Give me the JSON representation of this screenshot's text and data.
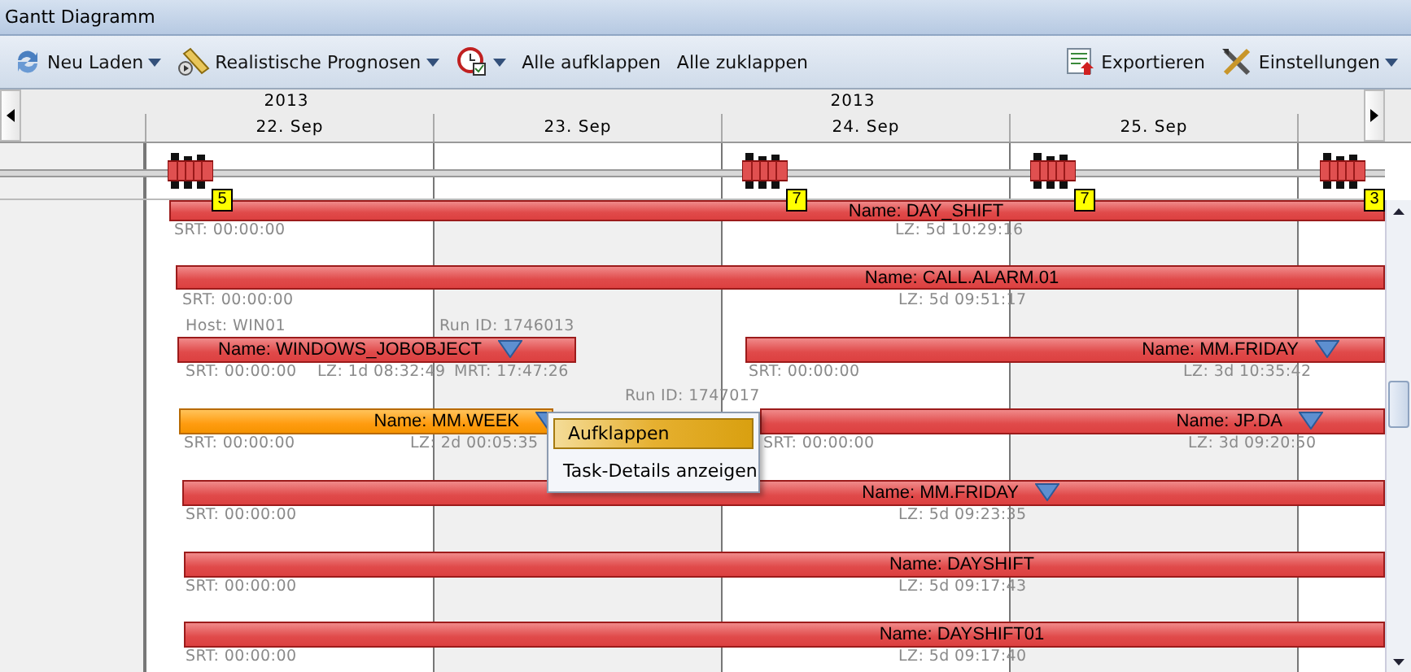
{
  "window": {
    "title": "Gantt Diagramm"
  },
  "toolbar": {
    "left": [
      {
        "label": "Neu Laden",
        "dropdown": true
      },
      {
        "label": "Realistische Prognosen",
        "dropdown": true
      },
      {
        "dropdown": true
      },
      {
        "label": "Alle aufklappen",
        "dropdown": false
      },
      {
        "label": "Alle zuklappen",
        "dropdown": false
      }
    ],
    "right": [
      {
        "label": "Exportieren",
        "dropdown": false
      },
      {
        "label": "Einstellungen",
        "dropdown": true
      }
    ]
  },
  "timeline": {
    "years": [
      "2013",
      "2013"
    ],
    "days": [
      "22. Sep",
      "23. Sep",
      "24. Sep",
      "25. Sep"
    ]
  },
  "markers": [
    {
      "count": "5"
    },
    {
      "count": "7"
    },
    {
      "count": "7"
    },
    {
      "count": "3"
    }
  ],
  "bars": [
    {
      "name": "Name: DAY_SHIFT",
      "selected": false,
      "expandable": false,
      "srt": "SRT: 00:00:00",
      "lz": "LZ: 5d 10:29:16"
    },
    {
      "name": "Name: CALL.ALARM.01",
      "selected": false,
      "expandable": false,
      "srt": "SRT: 00:00:00",
      "lz": "LZ: 5d 09:51:17"
    },
    {
      "name": "Name: WINDOWS_JOBOBJECT",
      "selected": false,
      "expandable": true,
      "host": "Host: WIN01",
      "run_id": "Run ID: 1746013",
      "srt": "SRT: 00:00:00",
      "lz": "LZ: 1d 08:32:49",
      "mrt": "MRT: 17:47:26"
    },
    {
      "name": "Name: MM.FRIDAY",
      "selected": false,
      "expandable": true,
      "srt": "SRT: 00:00:00",
      "lz": "LZ: 3d 10:35:42"
    },
    {
      "name": "Name: MM.WEEK",
      "selected": true,
      "expandable": true,
      "run_id": "Run ID: 1747017",
      "srt": "SRT: 00:00:00",
      "lz": "LZ: 2d 00:05:35"
    },
    {
      "name": "Name: JP.DA",
      "selected": false,
      "expandable": true,
      "srt": "SRT: 00:00:00",
      "lz": "LZ: 3d 09:20:50"
    },
    {
      "name": "Name: MM.FRIDAY",
      "selected": false,
      "expandable": true,
      "srt": "SRT: 00:00:00",
      "lz": "LZ: 5d 09:23:35"
    },
    {
      "name": "Name: DAYSHIFT",
      "selected": false,
      "expandable": false,
      "srt": "SRT: 00:00:00",
      "lz": "LZ: 5d 09:17:43"
    },
    {
      "name": "Name: DAYSHIFT01",
      "selected": false,
      "expandable": false,
      "srt": "SRT: 00:00:00",
      "lz": "LZ: 5d 09:17:40"
    }
  ],
  "context_menu": [
    {
      "label": "Aufklappen",
      "selected": true
    },
    {
      "label": "Task-Details anzeigen",
      "selected": false
    }
  ]
}
